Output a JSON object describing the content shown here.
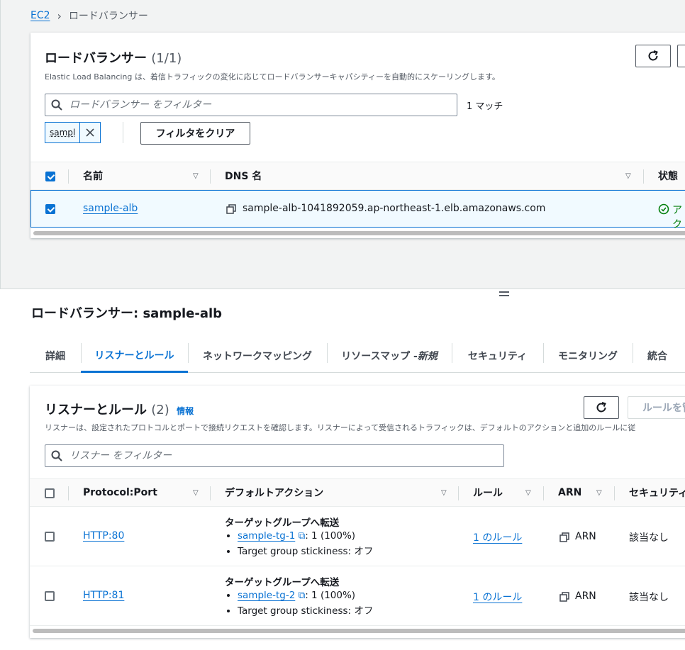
{
  "breadcrumb": {
    "root": "EC2",
    "current": "ロードバランサー"
  },
  "lb_panel": {
    "title": "ロードバランサー",
    "count": "(1/1)",
    "description": "Elastic Load Balancing は、着信トラフィックの変化に応じてロードバランサーキャパシティーを自動的にスケーリングします。",
    "search_placeholder": "ロードバランサー をフィルター",
    "match_count": "1 マッチ",
    "filter_token": "sampl",
    "clear_filter_label": "フィルタをクリア",
    "columns": {
      "name": "名前",
      "dns": "DNS 名",
      "state": "状態"
    },
    "rows": [
      {
        "name": "sample-alb",
        "dns": "sample-alb-1041892059.ap-northeast-1.elb.amazonaws.com",
        "state": "アク"
      }
    ]
  },
  "detail": {
    "title": "ロードバランサー: sample-alb",
    "tabs": [
      {
        "label": "詳細"
      },
      {
        "label": "リスナーとルール"
      },
      {
        "label": "ネットワークマッピング"
      },
      {
        "label": "リソースマップ - ",
        "emph": "新規"
      },
      {
        "label": "セキュリティ"
      },
      {
        "label": "モニタリング"
      },
      {
        "label": "統合"
      }
    ]
  },
  "listeners": {
    "title": "リスナーとルール",
    "count": "(2)",
    "info": "情報",
    "description": "リスナーは、設定されたプロトコルとポートで接続リクエストを確認します。リスナーによって受信されるトラフィックは、デフォルトのアクションと追加のルールに従",
    "rule_button": "ルールを管",
    "search_placeholder": "リスナー をフィルター",
    "columns": {
      "protocol": "Protocol:Port",
      "action": "デフォルトアクション",
      "rules": "ルール",
      "arn": "ARN",
      "security": "セキュリティ"
    },
    "rows": [
      {
        "protocol": "HTTP:80",
        "action_title": "ターゲットグループへ転送",
        "tg": "sample-tg-1",
        "tg_weight": ": 1 (100%)",
        "stickiness": "Target group stickiness: オフ",
        "rules": "1 のルール",
        "arn": "ARN",
        "security": "該当なし"
      },
      {
        "protocol": "HTTP:81",
        "action_title": "ターゲットグループへ転送",
        "tg": "sample-tg-2",
        "tg_weight": ": 1 (100%)",
        "stickiness": "Target group stickiness: オフ",
        "rules": "1 のルール",
        "arn": "ARN",
        "security": "該当なし"
      }
    ]
  },
  "colors": {
    "accent": "#0972d3",
    "success": "#037f0c",
    "text": "#16191f",
    "muted": "#545b64"
  }
}
